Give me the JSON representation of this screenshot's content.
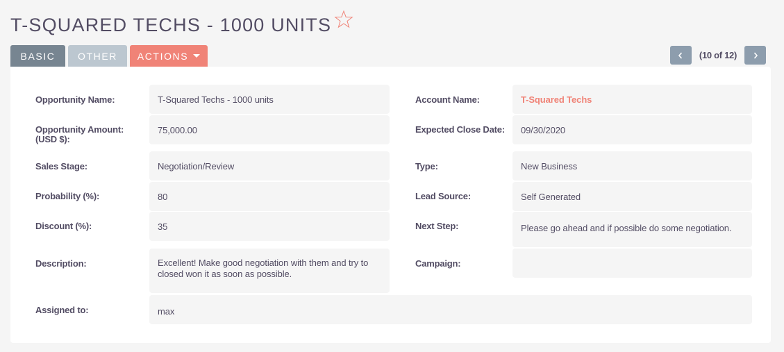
{
  "header": {
    "title": "T-SQUARED TECHS - 1000 UNITS",
    "favorite_icon": "star-outline-icon"
  },
  "tabs": [
    {
      "label": "BASIC",
      "active": true
    },
    {
      "label": "OTHER",
      "active": false
    },
    {
      "label": "ACTIONS",
      "has_dropdown": true
    }
  ],
  "pager": {
    "prev_icon": "chevron-left-icon",
    "count": "(10 of 12)",
    "next_icon": "chevron-right-icon"
  },
  "fields": {
    "opportunity_name": {
      "label": "Opportunity Name:",
      "value": "T-Squared Techs - 1000 units"
    },
    "opportunity_amount": {
      "label": "Opportunity Amount: (USD $):",
      "label_line1": "Opportunity Amount:",
      "label_line2": "(USD $):",
      "value": "75,000.00"
    },
    "sales_stage": {
      "label": "Sales Stage:",
      "value": "Negotiation/Review"
    },
    "probability": {
      "label": "Probability (%):",
      "value": "80"
    },
    "discount": {
      "label": "Discount (%):",
      "value": "35"
    },
    "description": {
      "label": "Description:",
      "value": "Excellent! Make good negotiation with them and try to closed won it as soon as possible."
    },
    "assigned_to": {
      "label": "Assigned to:",
      "value": "max"
    },
    "account_name": {
      "label": "Account Name:",
      "value": "T-Squared Techs"
    },
    "expected_close_date": {
      "label": "Expected Close Date:",
      "value": "09/30/2020"
    },
    "type": {
      "label": "Type:",
      "value": "New Business"
    },
    "lead_source": {
      "label": "Lead Source:",
      "value": "Self Generated"
    },
    "next_step": {
      "label": "Next Step:",
      "value": "Please go ahead and if possible do some negotiation."
    },
    "campaign": {
      "label": "Campaign:",
      "value": ""
    }
  },
  "colors": {
    "accent": "#f08377",
    "tab_active": "#778591",
    "tab_inactive": "#bcc7d0",
    "pager_button": "#8d9dad",
    "text": "#534d64",
    "field_bg": "#f5f5f5"
  }
}
